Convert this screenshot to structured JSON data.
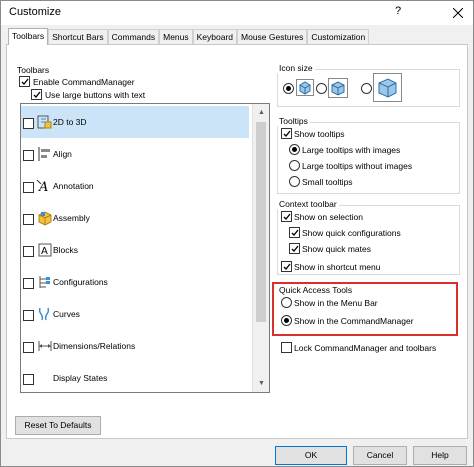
{
  "window": {
    "title": "Customize",
    "help": "?"
  },
  "tabs": [
    "Toolbars",
    "Shortcut Bars",
    "Commands",
    "Menus",
    "Keyboard",
    "Mouse Gestures",
    "Customization"
  ],
  "toolbars": {
    "group_title": "Toolbars",
    "enable_commandmanager": {
      "label": "Enable CommandManager",
      "checked": true
    },
    "use_large_buttons": {
      "label": "Use large buttons with text",
      "checked": true
    },
    "items": [
      {
        "name": "2D to 3D",
        "icon": "2d-to-3d-icon",
        "checked": false,
        "selected": true
      },
      {
        "name": "Align",
        "icon": "align-icon",
        "checked": false
      },
      {
        "name": "Annotation",
        "icon": "annotation-icon",
        "checked": false
      },
      {
        "name": "Assembly",
        "icon": "assembly-icon",
        "checked": false
      },
      {
        "name": "Blocks",
        "icon": "blocks-icon",
        "checked": false
      },
      {
        "name": "Configurations",
        "icon": "configurations-icon",
        "checked": false
      },
      {
        "name": "Curves",
        "icon": "curves-icon",
        "checked": false
      },
      {
        "name": "Dimensions/Relations",
        "icon": "dimensions-icon",
        "checked": false
      },
      {
        "name": "Display States",
        "icon": "display-states-icon",
        "checked": false
      }
    ]
  },
  "icon_size": {
    "group_title": "Icon size",
    "options": [
      "small",
      "medium",
      "large"
    ],
    "selected": "small"
  },
  "tooltips": {
    "group_title": "Tooltips",
    "show_tooltips": "Show tooltips",
    "large_with_images": "Large tooltips with images",
    "large_without_images": "Large tooltips without images",
    "small": "Small tooltips",
    "selected": "large_with_images"
  },
  "context_toolbar": {
    "group_title": "Context toolbar",
    "show_on_selection": "Show on selection",
    "show_quick_configurations": "Show quick configurations",
    "show_quick_mates": "Show quick mates",
    "show_in_shortcut_menu": "Show in shortcut menu"
  },
  "quick_access": {
    "group_title": "Quick Access Tools",
    "show_in_menu_bar": "Show in the Menu Bar",
    "show_in_commandmanager": "Show in the CommandManager",
    "selected": "show_in_commandmanager",
    "highlight_color": "#d9302c"
  },
  "lock_commandmanager": {
    "label": "Lock CommandManager and toolbars",
    "checked": false
  },
  "buttons": {
    "reset": "Reset To Defaults",
    "ok": "OK",
    "cancel": "Cancel",
    "help": "Help"
  },
  "colors": {
    "selection": "#cce4f7",
    "accent": "#0078d7",
    "icon_blue": "#3a8fd0"
  }
}
